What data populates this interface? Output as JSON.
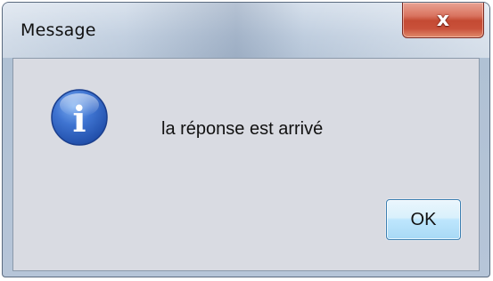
{
  "window": {
    "title": "Message",
    "close_glyph": "x",
    "close_icon": "close-icon",
    "frame_color": "#b0c1d4",
    "close_button_color": "#c44a33"
  },
  "dialog": {
    "icon": "info-icon",
    "icon_letter": "i",
    "icon_color": "#2a5cb8",
    "message": "la réponse est arrivé",
    "ok_label": "OK",
    "background_color": "#d9dbe2"
  }
}
